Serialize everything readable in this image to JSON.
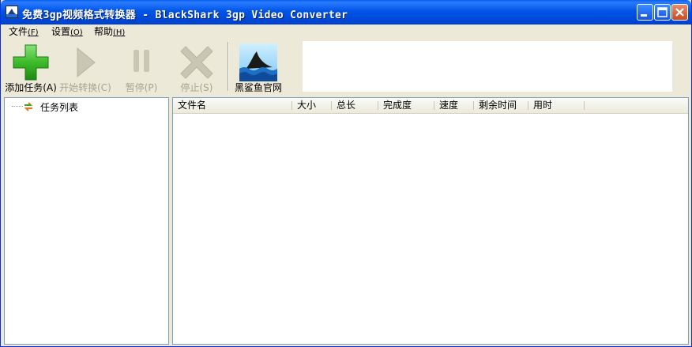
{
  "window": {
    "title": "免费3gp视频格式转换器 - BlackShark 3gp Video Converter"
  },
  "menu": [
    {
      "label": "文件",
      "accel": "(F)"
    },
    {
      "label": "设置",
      "accel": "(O)"
    },
    {
      "label": "帮助",
      "accel": "(H)"
    }
  ],
  "toolbar": {
    "buttons": [
      {
        "label": "添加任务(A)",
        "icon": "plus-icon",
        "enabled": true
      },
      {
        "label": "开始转换(C)",
        "icon": "play-icon",
        "enabled": false
      },
      {
        "label": "暂停(P)",
        "icon": "pause-icon",
        "enabled": false
      },
      {
        "label": "停止(S)",
        "icon": "stop-x-icon",
        "enabled": false
      },
      {
        "label": "黑鲨鱼官网",
        "icon": "shark-logo-icon",
        "enabled": true
      }
    ]
  },
  "tree": {
    "root_label": "任务列表"
  },
  "list": {
    "columns": [
      "文件名",
      "大小",
      "总长",
      "完成度",
      "速度",
      "剩余时间",
      "用时"
    ],
    "rows": []
  },
  "colors": {
    "titlebar": "#0055E5",
    "toolbar_bg": "#ECE9D8",
    "add_green": "#3DBA2A",
    "disabled_gray": "#A7A590",
    "pane_border": "#7F9DB9"
  }
}
